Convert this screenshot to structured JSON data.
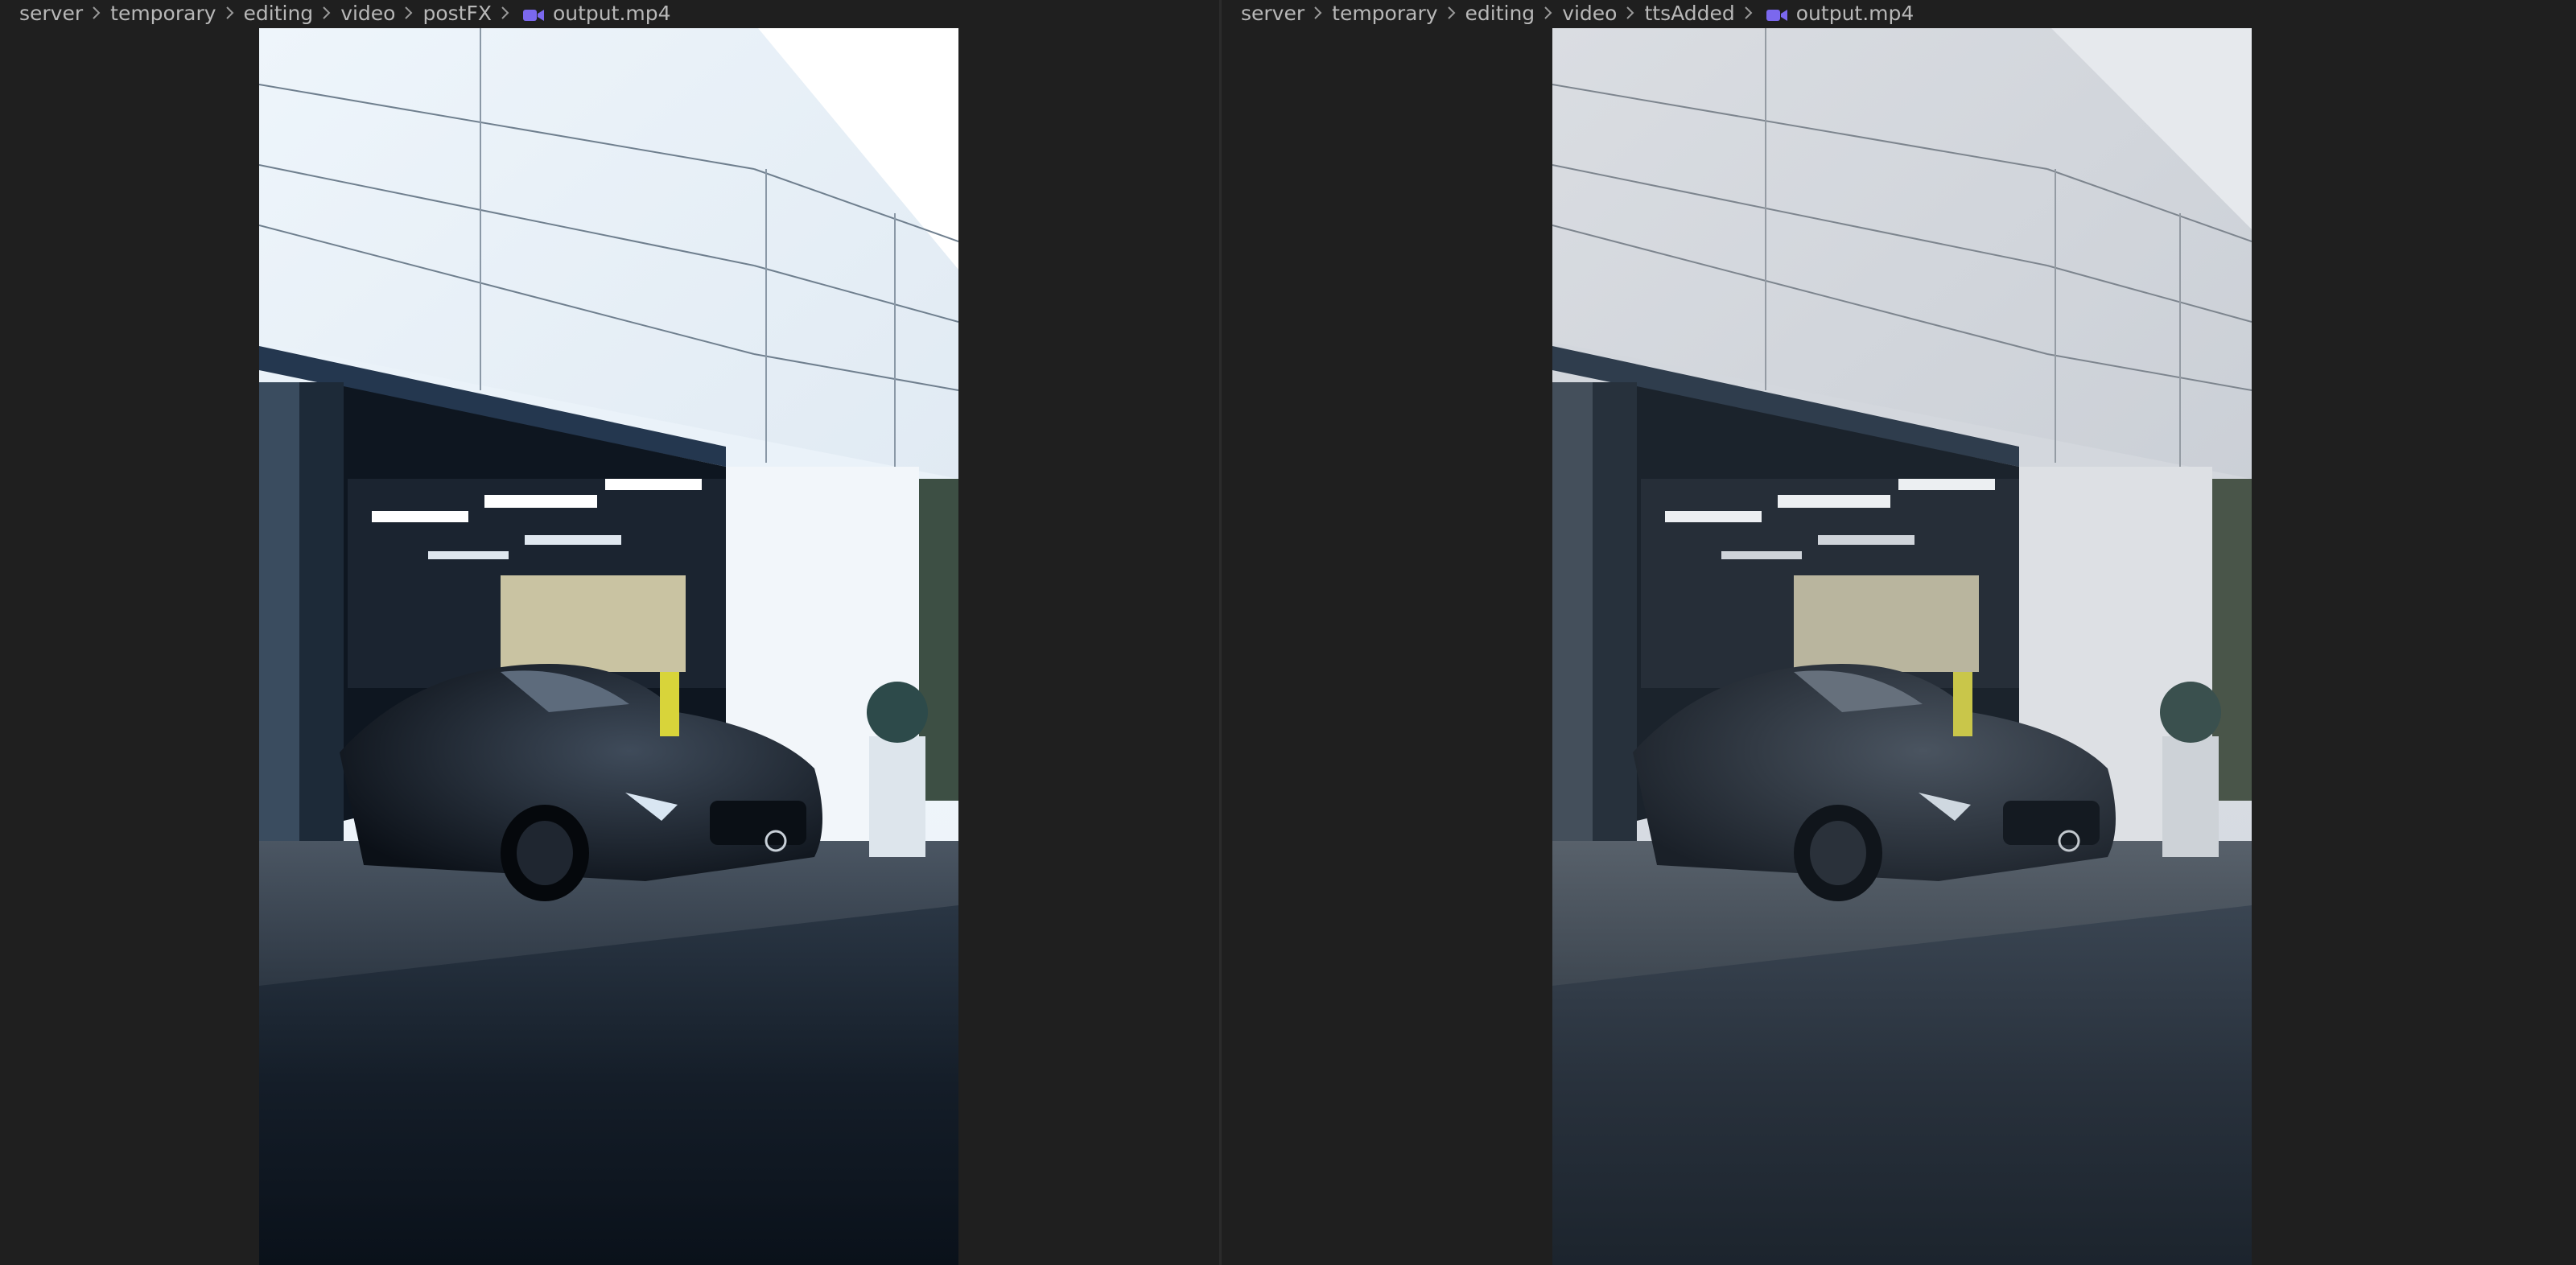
{
  "editor_left": {
    "breadcrumb": [
      "server",
      "temporary",
      "editing",
      "video",
      "postFX"
    ],
    "file_name": "output.mp4",
    "file_icon": "video-camera-icon",
    "video_tone": "high-contrast"
  },
  "editor_right": {
    "breadcrumb": [
      "server",
      "temporary",
      "editing",
      "video",
      "ttsAdded"
    ],
    "file_name": "output.mp4",
    "file_icon": "video-camera-icon",
    "video_tone": "muted"
  },
  "colors": {
    "background": "#1f1f1f",
    "breadcrumb_text": "#b8b8b8",
    "video_icon": "#7b68ee",
    "divider": "#2b2b2b"
  }
}
